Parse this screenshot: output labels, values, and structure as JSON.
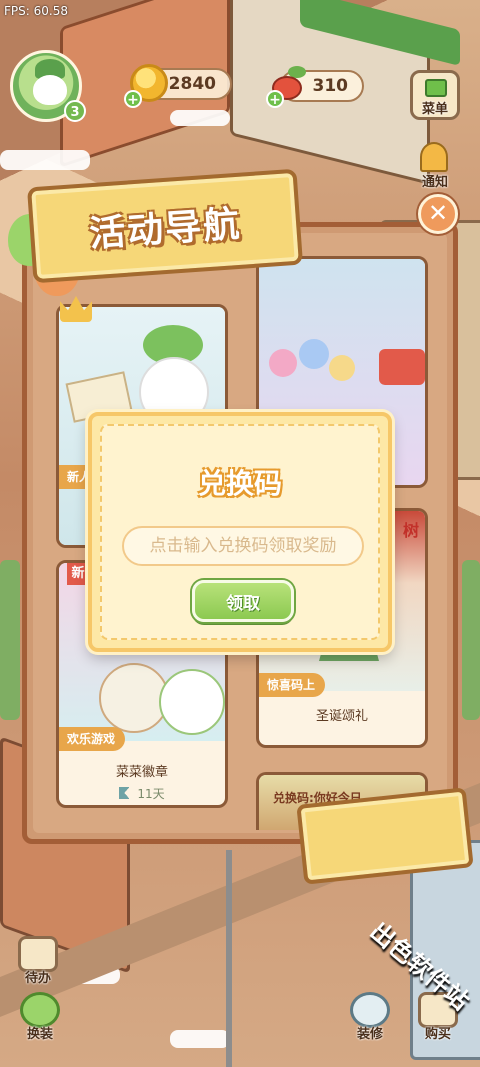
{
  "status": {
    "fps": "FPS: 60.58"
  },
  "hud": {
    "level": "3",
    "coins": "2840",
    "radishes": "310",
    "menu_label": "菜单",
    "notify_label": "通知",
    "icons": [
      "coin-icon",
      "radish-icon",
      "gift-icon",
      "bell-icon",
      "close-icon"
    ]
  },
  "activity_panel": {
    "title": "活动导航",
    "cards": [
      {
        "tag": "新人",
        "name": "",
        "time": ""
      },
      {
        "tag": "",
        "name": "",
        "time": ""
      },
      {
        "tag": "欢乐游戏",
        "name": "菜菜徽章",
        "time": "11天"
      },
      {
        "tag": "惊喜码上",
        "name": "圣诞颂礼",
        "time": ""
      },
      {
        "tag": "",
        "name": "",
        "time": ""
      }
    ],
    "card_badges": {
      "new": "新"
    },
    "card_signs": {
      "xmas_sign": "树",
      "bottom_sign": "兑换码:你好今日"
    }
  },
  "redeem_modal": {
    "title": "兑换码",
    "placeholder": "点击输入兑换码领取奖励",
    "claim_label": "领取"
  },
  "bottom": {
    "todo_label": "待办",
    "dress_label": "换装",
    "decor_label": "装修",
    "shop_label": "购买"
  },
  "watermark": "出色软件站",
  "colors": {
    "accent_green": "#8cc951",
    "panel_brown": "#a35e37",
    "banner_gold": "#f6d778",
    "modal_bg": "#fde8a6"
  }
}
